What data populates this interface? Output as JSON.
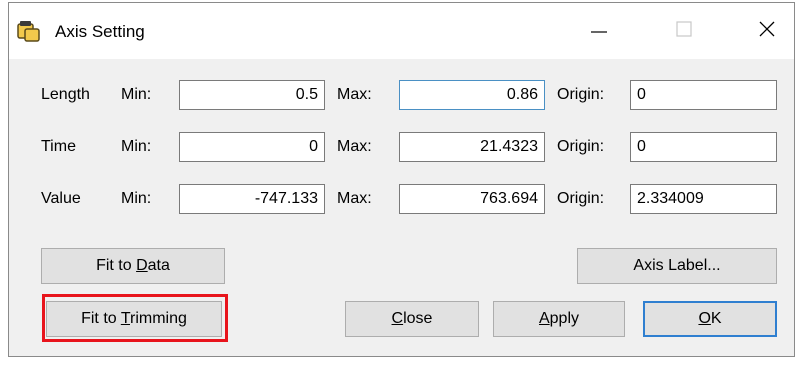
{
  "window": {
    "title": "Axis Setting",
    "icon": "axis-setting-app-icon"
  },
  "labels": {
    "min": "Min:",
    "max": "Max:",
    "origin": "Origin:"
  },
  "rows": [
    {
      "name": "Length",
      "min": "0.5",
      "max": "0.86",
      "origin": "0"
    },
    {
      "name": "Time",
      "min": "0",
      "max": "21.4323",
      "origin": "0"
    },
    {
      "name": "Value",
      "min": "-747.133",
      "max": "763.694",
      "origin": "2.334009"
    }
  ],
  "buttons": {
    "fit_to_data": {
      "pre": "Fit to ",
      "mnemonic": "D",
      "post": "ata"
    },
    "axis_label": "Axis Label...",
    "fit_to_trimming": {
      "pre": "Fit to ",
      "mnemonic": "T",
      "post": "rimming"
    },
    "close": {
      "mnemonic": "C",
      "post": "lose"
    },
    "apply": {
      "mnemonic": "A",
      "post": "pply"
    },
    "ok": {
      "mnemonic": "O",
      "post": "K"
    }
  },
  "colors": {
    "highlight": "#e8141c",
    "default_button_border": "#2f7fd0",
    "focus_field_border": "#4a90c4"
  }
}
